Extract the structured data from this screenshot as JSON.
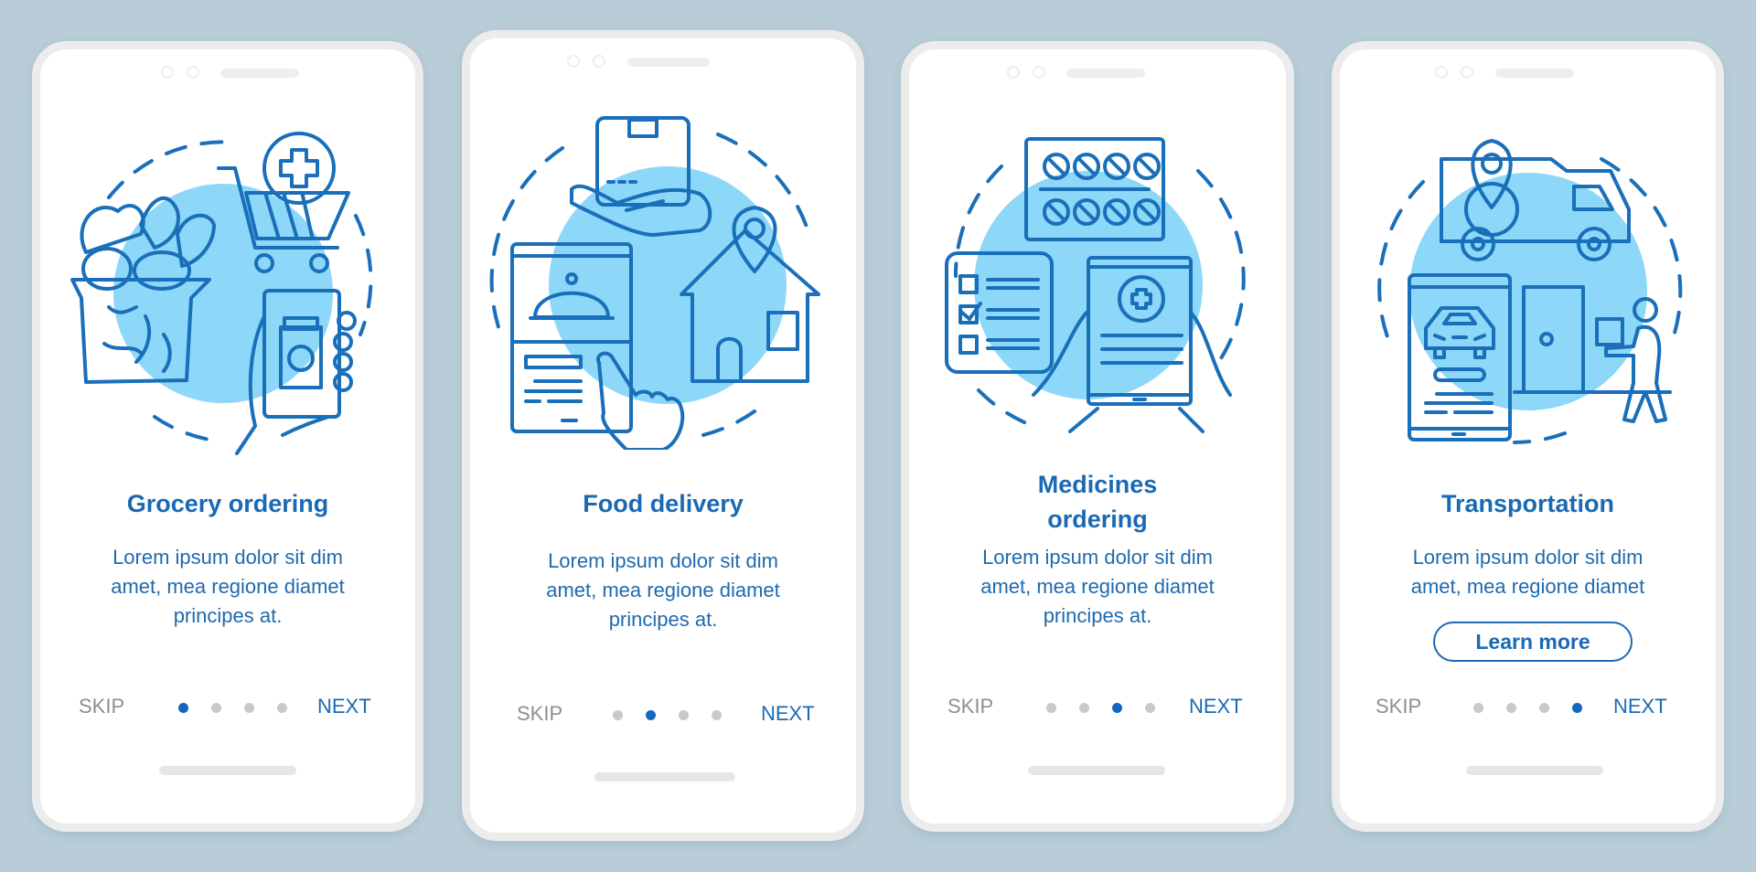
{
  "colors": {
    "background": "#b8cdd8",
    "accent": "#1a69b4",
    "illustration_circle": "#8dd8f8",
    "illustration_pale": "#cdeefb",
    "illustration_mid": "#5aaef0",
    "inactive_dot": "#c9c9c9",
    "skip_text": "#8f8f8f"
  },
  "screens": [
    {
      "illustration": "grocery-ordering-illustration",
      "title_lines": [
        "Grocery ordering"
      ],
      "body_lines": [
        "Lorem ipsum dolor sit dim",
        "amet, mea regione diamet",
        "principes at."
      ],
      "skip_label": "SKIP",
      "next_label": "NEXT",
      "page_count": 4,
      "active_page": 1
    },
    {
      "illustration": "food-delivery-illustration",
      "title_lines": [
        "Food delivery"
      ],
      "body_lines": [
        "Lorem ipsum dolor sit dim",
        "amet, mea regione diamet",
        "principes at."
      ],
      "skip_label": "SKIP",
      "next_label": "NEXT",
      "page_count": 4,
      "active_page": 2
    },
    {
      "illustration": "medicines-ordering-illustration",
      "title_lines": [
        "Medicines",
        "ordering"
      ],
      "body_lines": [
        "Lorem ipsum dolor sit dim",
        "amet, mea regione diamet",
        "principes at."
      ],
      "skip_label": "SKIP",
      "next_label": "NEXT",
      "page_count": 4,
      "active_page": 3
    },
    {
      "illustration": "transportation-illustration",
      "title_lines": [
        "Transportation"
      ],
      "body_lines": [
        "Lorem ipsum dolor sit dim",
        "amet, mea regione diamet"
      ],
      "button_label": "Learn more",
      "skip_label": "SKIP",
      "next_label": "NEXT",
      "page_count": 4,
      "active_page": 4
    }
  ]
}
